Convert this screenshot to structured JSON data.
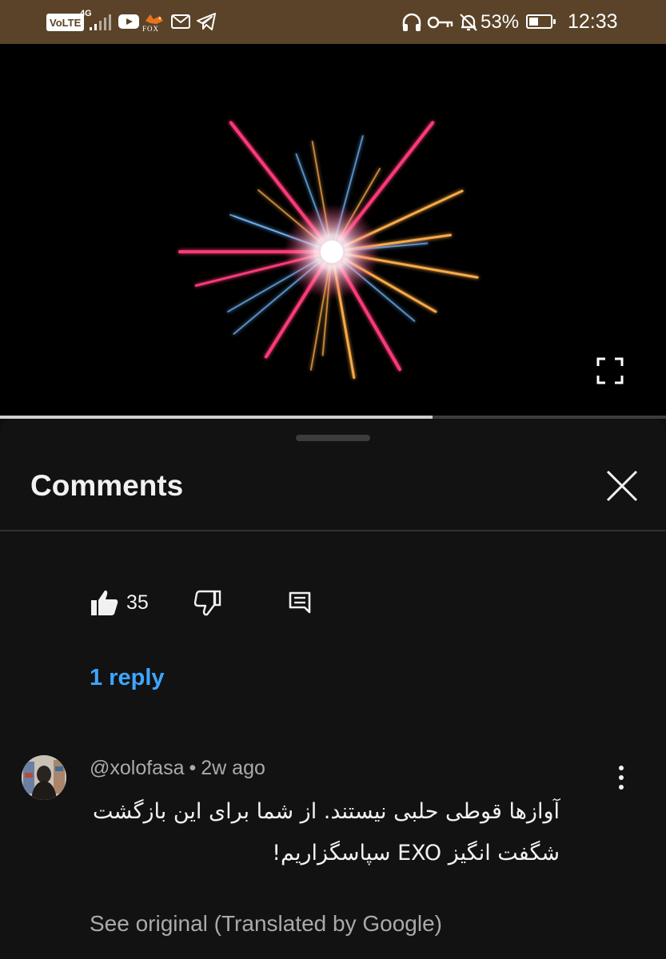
{
  "status_bar": {
    "volte_label": "VoLTE",
    "network_label": "4G",
    "fox_label": "FOX",
    "battery_percent": "53%",
    "battery_level": 0.53,
    "time": "12:33",
    "left_icons": [
      "volte-icon",
      "signal-icon",
      "youtube-icon",
      "fox-app-icon",
      "mail-icon",
      "telegram-icon"
    ],
    "right_icons": [
      "headphones-icon",
      "vpn-key-icon",
      "bell-off-icon",
      "battery-icon"
    ]
  },
  "video": {
    "progress": 0.65,
    "fullscreen_icon": "fullscreen-icon",
    "colors": {
      "pink": "#ff3c78",
      "orange": "#ffae4a",
      "blue": "#6fb8ff",
      "core": "#ffffff"
    }
  },
  "comments_panel": {
    "title": "Comments",
    "close_icon": "close-icon",
    "actions": {
      "like_count": "35",
      "like_icon": "thumbs-up-icon",
      "dislike_icon": "thumbs-down-icon",
      "reply_icon": "comment-reply-icon"
    },
    "replies_label": "1 reply",
    "comment": {
      "author": "@xolofasa",
      "separator": "•",
      "time": "2w ago",
      "text": "آوازها قوطی حلبی نیستند. از شما برای این بازگشت شگفت انگیز EXO سپاسگزاریم!",
      "see_original": "See original (Translated by Google)",
      "more_icon": "more-vertical-icon"
    },
    "accent_color": "#3ea6ff"
  }
}
